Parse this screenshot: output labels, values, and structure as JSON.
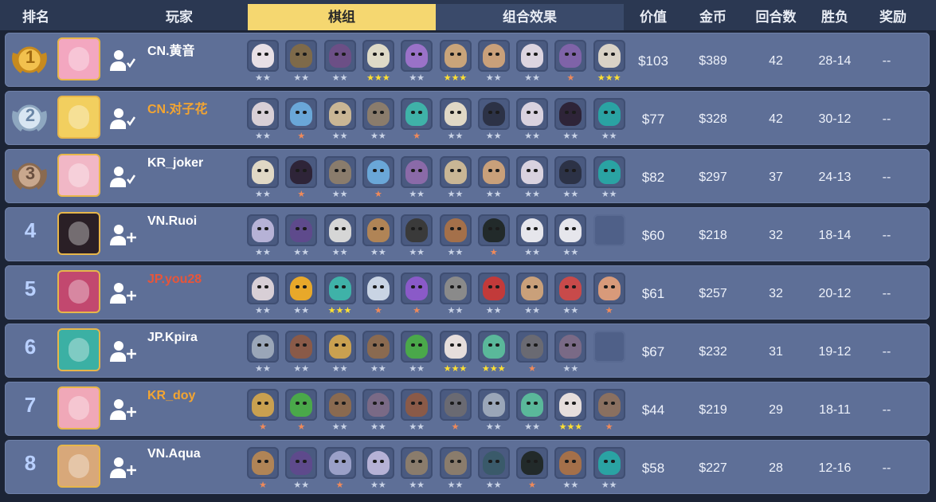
{
  "header": {
    "rank": "排名",
    "player": "玩家",
    "tab_lineup": "棋组",
    "tab_synergy": "组合效果",
    "value": "价值",
    "gold": "金币",
    "rounds": "回合数",
    "record": "胜负",
    "reward": "奖励"
  },
  "colors": {
    "active_tab": "#f5d770",
    "row_bg": "#5e6f97",
    "name_white": "#ffffff",
    "name_orange": "#f4a531",
    "name_red": "#e8553a",
    "star_grey": "#c9d3e6",
    "star_gold": "#ffe032",
    "star_orange": "#f08a5a"
  },
  "players": [
    {
      "rank": "1",
      "badge": "gold",
      "name": "CN.黄音",
      "name_color": "#ffffff",
      "friend": "added-friend-icon",
      "avatar_color": "#f3a7c0",
      "value": "$103",
      "gold": "$389",
      "rounds": "42",
      "record": "28-14",
      "reward": "--",
      "units": [
        {
          "c": "#e8e0e6",
          "s": 2
        },
        {
          "c": "#7e6a4a",
          "s": 2
        },
        {
          "c": "#6c4f86",
          "s": 2
        },
        {
          "c": "#dedac7",
          "s": 3
        },
        {
          "c": "#9a72c8",
          "s": 2
        },
        {
          "c": "#c9a47a",
          "s": 3
        },
        {
          "c": "#c9a07a",
          "s": 2
        },
        {
          "c": "#dcd4e0",
          "s": 2
        },
        {
          "c": "#7f63a8",
          "s": 1
        },
        {
          "c": "#d9d2c6",
          "s": 3
        }
      ]
    },
    {
      "rank": "2",
      "badge": "silver",
      "name": "CN.对子花",
      "name_color": "#f4a531",
      "friend": "added-friend-icon",
      "avatar_color": "#f2cf5f",
      "value": "$77",
      "gold": "$328",
      "rounds": "42",
      "record": "30-12",
      "reward": "--",
      "units": [
        {
          "c": "#d8cfd6",
          "s": 2
        },
        {
          "c": "#6aa7d8",
          "s": 1
        },
        {
          "c": "#c9b695",
          "s": 2
        },
        {
          "c": "#8a7c6c",
          "s": 2
        },
        {
          "c": "#3fb2a8",
          "s": 1
        },
        {
          "c": "#e0d8c5",
          "s": 2
        },
        {
          "c": "#2c3246",
          "s": 2
        },
        {
          "c": "#d9d2df",
          "s": 2
        },
        {
          "c": "#2e2438",
          "s": 2
        },
        {
          "c": "#2aa3a3",
          "s": 2
        }
      ]
    },
    {
      "rank": "3",
      "badge": "bronze",
      "name": "KR_joker",
      "name_color": "#ffffff",
      "friend": "added-friend-icon",
      "avatar_color": "#f1b7c6",
      "value": "$82",
      "gold": "$297",
      "rounds": "37",
      "record": "24-13",
      "reward": "--",
      "units": [
        {
          "c": "#e0d8c5",
          "s": 2
        },
        {
          "c": "#2e2438",
          "s": 1
        },
        {
          "c": "#8a7c6c",
          "s": 2
        },
        {
          "c": "#6aa7d8",
          "s": 1
        },
        {
          "c": "#8a6aa8",
          "s": 2
        },
        {
          "c": "#c9b695",
          "s": 2
        },
        {
          "c": "#c9a07a",
          "s": 2
        },
        {
          "c": "#d9d2df",
          "s": 2
        },
        {
          "c": "#2c3246",
          "s": 2
        },
        {
          "c": "#2aa3a3",
          "s": 2
        }
      ]
    },
    {
      "rank": "4",
      "badge": "none",
      "name": "VN.Ruoi",
      "name_color": "#ffffff",
      "friend": "add-friend-icon",
      "avatar_color": "#2a1f26",
      "value": "$60",
      "gold": "$218",
      "rounds": "32",
      "record": "18-14",
      "reward": "--",
      "units": [
        {
          "c": "#b6b2d6",
          "s": 2
        },
        {
          "c": "#5e4a8c",
          "s": 2
        },
        {
          "c": "#d6d6d6",
          "s": 2
        },
        {
          "c": "#b08456",
          "s": 2
        },
        {
          "c": "#3a3a3a",
          "s": 2
        },
        {
          "c": "#a4704a",
          "s": 2
        },
        {
          "c": "#222a2a",
          "s": 1
        },
        {
          "c": "#e6e6ec",
          "s": 2
        },
        {
          "c": "#e6e6ec",
          "s": 2
        },
        {
          "c": "",
          "s": 0
        }
      ]
    },
    {
      "rank": "5",
      "badge": "none",
      "name": "JP.you28",
      "name_color": "#e8553a",
      "friend": "add-friend-icon",
      "avatar_color": "#c2486f",
      "value": "$61",
      "gold": "$257",
      "rounds": "32",
      "record": "20-12",
      "reward": "--",
      "units": [
        {
          "c": "#d8cfd6",
          "s": 2
        },
        {
          "c": "#e8a82a",
          "s": 2
        },
        {
          "c": "#3fb2a8",
          "s": 3
        },
        {
          "c": "#c9d4e4",
          "s": 1
        },
        {
          "c": "#8a5ac8",
          "s": 1
        },
        {
          "c": "#8a8a8a",
          "s": 2
        },
        {
          "c": "#c23a3a",
          "s": 2
        },
        {
          "c": "#c9a07a",
          "s": 2
        },
        {
          "c": "#c84a4a",
          "s": 2
        },
        {
          "c": "#d89a7a",
          "s": 1
        }
      ]
    },
    {
      "rank": "6",
      "badge": "none",
      "name": "JP.Kpira",
      "name_color": "#ffffff",
      "friend": "add-friend-icon",
      "avatar_color": "#3bb0a4",
      "value": "$67",
      "gold": "$232",
      "rounds": "31",
      "record": "19-12",
      "reward": "--",
      "units": [
        {
          "c": "#9aa6b8",
          "s": 2
        },
        {
          "c": "#8a5a48",
          "s": 2
        },
        {
          "c": "#c9a050",
          "s": 2
        },
        {
          "c": "#8a6a50",
          "s": 2
        },
        {
          "c": "#4aa84a",
          "s": 2
        },
        {
          "c": "#e6dedc",
          "s": 3
        },
        {
          "c": "#5ab89a",
          "s": 3
        },
        {
          "c": "#6a6a72",
          "s": 1
        },
        {
          "c": "#7a6a86",
          "s": 2
        },
        {
          "c": "",
          "s": 0
        }
      ]
    },
    {
      "rank": "7",
      "badge": "none",
      "name": "KR_doy",
      "name_color": "#f4a531",
      "friend": "add-friend-icon",
      "avatar_color": "#f0a8b8",
      "value": "$44",
      "gold": "$219",
      "rounds": "29",
      "record": "18-11",
      "reward": "--",
      "units": [
        {
          "c": "#c9a050",
          "s": 1
        },
        {
          "c": "#4aa84a",
          "s": 1
        },
        {
          "c": "#8a6a50",
          "s": 2
        },
        {
          "c": "#7a6a86",
          "s": 2
        },
        {
          "c": "#8a5a48",
          "s": 2
        },
        {
          "c": "#6a6a72",
          "s": 1
        },
        {
          "c": "#9aa6b8",
          "s": 2
        },
        {
          "c": "#5ab89a",
          "s": 2
        },
        {
          "c": "#e6dedc",
          "s": 3
        },
        {
          "c": "#8a7060",
          "s": 1
        }
      ]
    },
    {
      "rank": "8",
      "badge": "none",
      "name": "VN.Aqua",
      "name_color": "#ffffff",
      "friend": "add-friend-icon",
      "avatar_color": "#d8a87a",
      "value": "$58",
      "gold": "$227",
      "rounds": "28",
      "record": "12-16",
      "reward": "--",
      "units": [
        {
          "c": "#b08456",
          "s": 1
        },
        {
          "c": "#5e4a8c",
          "s": 2
        },
        {
          "c": "#9aa0c8",
          "s": 1
        },
        {
          "c": "#b6b2d6",
          "s": 2
        },
        {
          "c": "#8a7c6c",
          "s": 2
        },
        {
          "c": "#8a7c6c",
          "s": 2
        },
        {
          "c": "#3a5a6a",
          "s": 2
        },
        {
          "c": "#222a2a",
          "s": 1
        },
        {
          "c": "#a4704a",
          "s": 2
        },
        {
          "c": "#2aa3a3",
          "s": 2
        }
      ]
    }
  ]
}
